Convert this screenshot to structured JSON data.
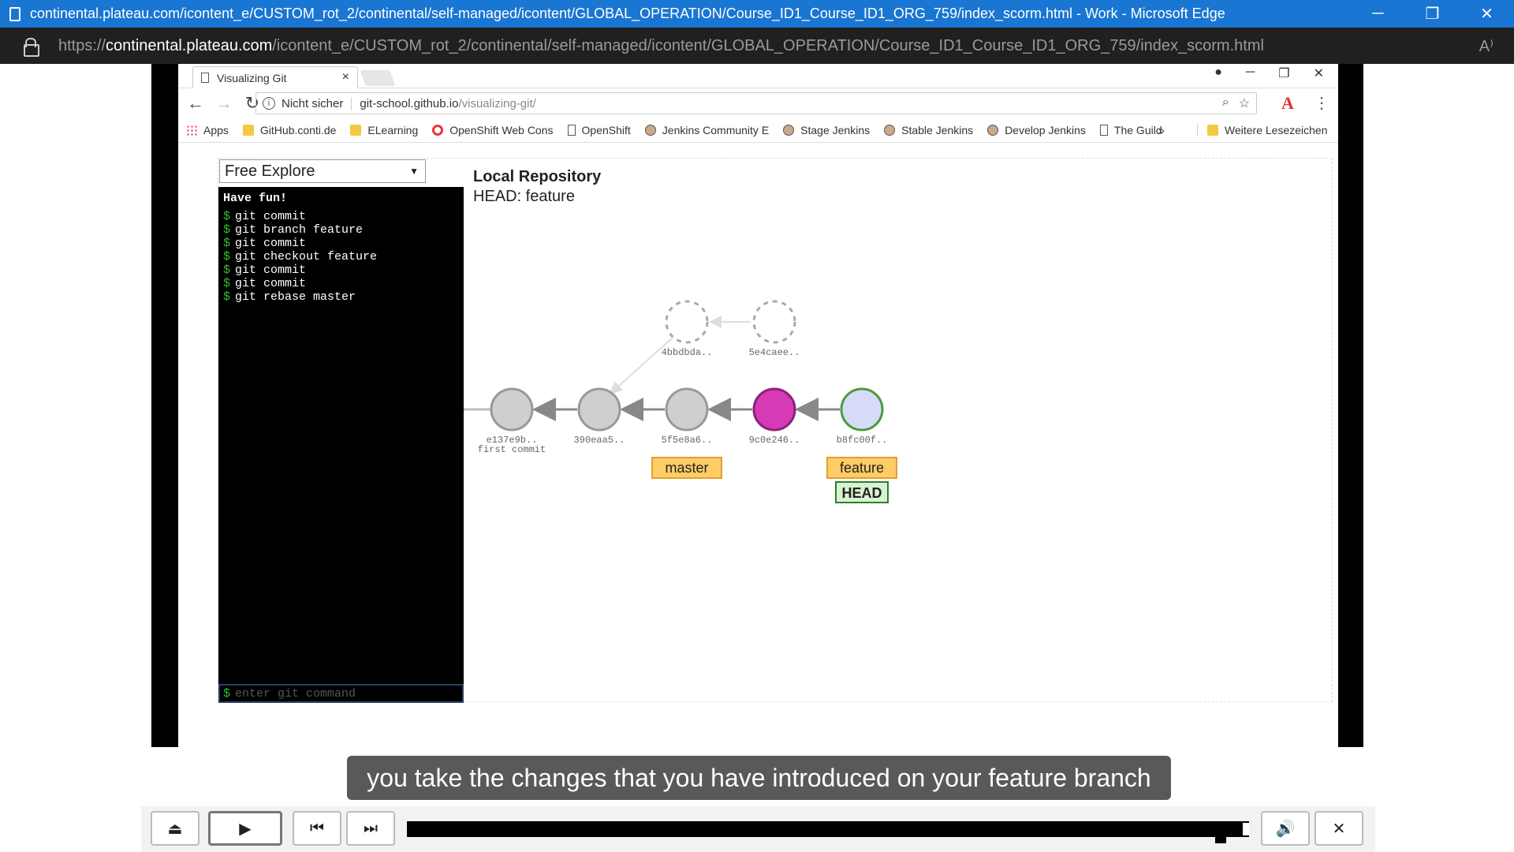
{
  "edge": {
    "title": "continental.plateau.com/icontent_e/CUSTOM_rot_2/continental/self-managed/icontent/GLOBAL_OPERATION/Course_ID1_Course_ID1_ORG_759/index_scorm.html - Work - Microsoft Edge",
    "url_host": "continental.plateau.com",
    "url_prefix": "https://",
    "url_path": "/icontent_e/CUSTOM_rot_2/continental/self-managed/icontent/GLOBAL_OPERATION/Course_ID1_Course_ID1_ORG_759/index_scorm.html",
    "minimize": "─",
    "restore": "❐",
    "close": "✕",
    "read_aloud": "A⁾"
  },
  "chrome": {
    "tab_title": "Visualizing Git",
    "tab_close": "×",
    "not_secure": "Nicht sicher",
    "site": "git-school.github.io",
    "path": "/visualizing-git/",
    "back": "←",
    "forward": "→",
    "reload": "↻",
    "win_min": "─",
    "win_max": "❐",
    "win_close": "✕",
    "profile": "●"
  },
  "bookmarks": [
    {
      "label": "Apps",
      "icon": "apps-icon"
    },
    {
      "label": "GitHub.conti.de",
      "icon": "folder-icon"
    },
    {
      "label": "ELearning",
      "icon": "folder-icon"
    },
    {
      "label": "OpenShift Web Cons",
      "icon": "redhat-icon"
    },
    {
      "label": "OpenShift",
      "icon": "page-icon"
    },
    {
      "label": "Jenkins Community E",
      "icon": "jenkins-icon"
    },
    {
      "label": "Stage Jenkins",
      "icon": "jenkins-icon"
    },
    {
      "label": "Stable Jenkins",
      "icon": "jenkins-icon"
    },
    {
      "label": "Develop Jenkins",
      "icon": "jenkins-icon"
    },
    {
      "label": "The Guild",
      "icon": "page-icon"
    }
  ],
  "bookmarks_more": "»",
  "bookmarks_other": "Weitere Lesezeichen",
  "app": {
    "mode": "Free Explore",
    "terminal_header": "Have fun!",
    "commands": [
      "git commit",
      "git branch feature",
      "git commit",
      "git checkout feature",
      "git commit",
      "git commit",
      "git rebase master"
    ],
    "input_placeholder": "enter git command",
    "repo_title": "Local Repository",
    "repo_head": "HEAD: feature"
  },
  "graph": {
    "commits": [
      {
        "id": "e137e9b..",
        "label": "first commit",
        "style": "normal"
      },
      {
        "id": "390eaa5..",
        "style": "normal"
      },
      {
        "id": "5f5e8a6..",
        "style": "normal"
      },
      {
        "id": "9c0e246..",
        "style": "highlight",
        "color": "#d63ab5"
      },
      {
        "id": "b8fc00f..",
        "style": "head",
        "color": "#d6dcf7"
      }
    ],
    "orphaned": [
      {
        "id": "4bbdbda.."
      },
      {
        "id": "5e4caee.."
      }
    ],
    "branches": [
      {
        "name": "master",
        "at": "5f5e8a6.."
      },
      {
        "name": "feature",
        "at": "b8fc00f.."
      }
    ],
    "head_tag": "HEAD",
    "colors": {
      "branch": "#ffcc66",
      "head_border": "#4b9b3b",
      "normal": "#cfcfcf"
    }
  },
  "subtitle": "you take the changes that you have introduced on your feature branch",
  "player": {
    "exit": "⏏",
    "play": "▶",
    "prev": "⏮",
    "next": "⏭",
    "volume": "🔊",
    "close": "✕",
    "progress": 0.98
  }
}
